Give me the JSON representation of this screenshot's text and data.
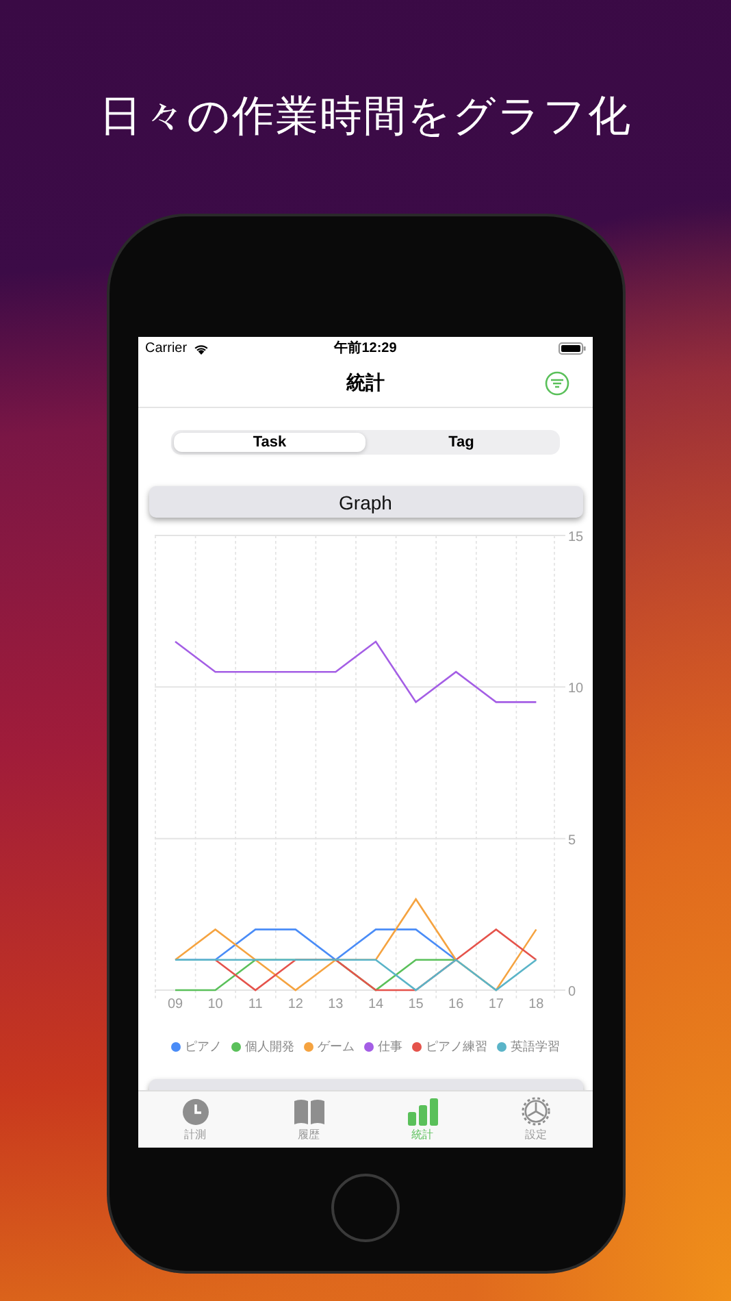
{
  "headline": "日々の作業時間をグラフ化",
  "status_bar": {
    "carrier": "Carrier",
    "time": "午前12:29"
  },
  "nav": {
    "title": "統計"
  },
  "segments": [
    {
      "label": "Task",
      "selected": true
    },
    {
      "label": "Tag",
      "selected": false
    }
  ],
  "graph_button": "Graph",
  "chart_data": {
    "type": "line",
    "categories": [
      "09",
      "10",
      "11",
      "12",
      "13",
      "14",
      "15",
      "16",
      "17",
      "18"
    ],
    "ylim": [
      0,
      15
    ],
    "yticks": [
      0,
      5,
      10,
      15
    ],
    "series": [
      {
        "name": "ピアノ",
        "color": "#4a8cf7",
        "values": [
          1,
          1,
          2,
          2,
          1,
          2,
          2,
          1,
          null,
          null
        ]
      },
      {
        "name": "個人開発",
        "color": "#5ac05a",
        "values": [
          0,
          0,
          1,
          1,
          1,
          0,
          1,
          1,
          null,
          null
        ]
      },
      {
        "name": "ゲーム",
        "color": "#f5a340",
        "values": [
          1,
          2,
          1,
          0,
          1,
          1,
          3,
          1,
          0,
          2
        ]
      },
      {
        "name": "仕事",
        "color": "#a45ee5",
        "values": [
          11.5,
          10.5,
          10.5,
          10.5,
          10.5,
          11.5,
          9.5,
          10.5,
          9.5,
          9.5
        ]
      },
      {
        "name": "ピアノ練習",
        "color": "#e5534b",
        "values": [
          null,
          1,
          0,
          1,
          1,
          0,
          0,
          1,
          2,
          1
        ]
      },
      {
        "name": "英語学習",
        "color": "#5ab4c8",
        "values": [
          1,
          1,
          1,
          1,
          1,
          1,
          0,
          1,
          0,
          1
        ]
      }
    ]
  },
  "tabs": [
    {
      "label": "計測",
      "kind": "clock",
      "selected": false
    },
    {
      "label": "履歴",
      "kind": "book",
      "selected": false
    },
    {
      "label": "統計",
      "kind": "chart",
      "selected": true
    },
    {
      "label": "設定",
      "kind": "gear",
      "selected": false
    }
  ]
}
